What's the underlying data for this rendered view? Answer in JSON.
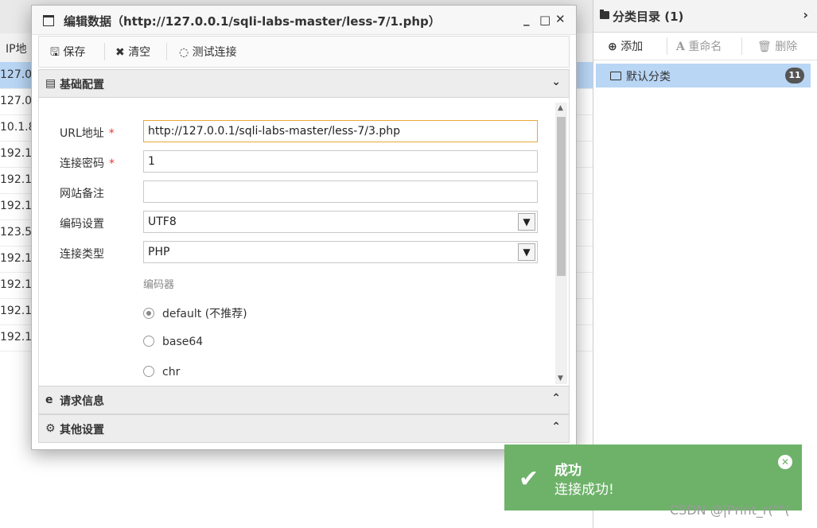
{
  "background_table": {
    "header": "IP地",
    "rows": [
      "127.0",
      "127.0",
      "10.1.8",
      "192.1",
      "192.1",
      "192.1",
      "123.5",
      "192.1",
      "192.1",
      "192.1",
      "192.1"
    ]
  },
  "right_panel": {
    "title": "分类目录 (1)",
    "buttons": {
      "add": "添加",
      "rename": "重命名",
      "delete": "删除"
    },
    "tree": {
      "label": "默认分类",
      "count": "11"
    }
  },
  "dialog": {
    "title": "编辑数据（http://127.0.0.1/sqli-labs-master/less-7/1.php）",
    "toolbar": {
      "save": "保存",
      "clear": "清空",
      "test": "测试连接"
    },
    "sections": {
      "basic": "基础配置",
      "request": "请求信息",
      "other": "其他设置"
    },
    "form": {
      "url_label": "URL地址",
      "url_value": "http://127.0.0.1/sqli-labs-master/less-7/3.php",
      "password_label": "连接密码",
      "password_value": "1",
      "note_label": "网站备注",
      "note_value": "",
      "encoding_label": "编码设置",
      "encoding_value": "UTF8",
      "type_label": "连接类型",
      "type_value": "PHP",
      "encoder_label": "编码器",
      "encoders": [
        "default (不推荐)",
        "base64",
        "chr"
      ],
      "required_mark": "*"
    }
  },
  "toast": {
    "title": "成功",
    "message": "连接成功!",
    "color": "#6eb26a"
  },
  "watermark": "CSDN @|Print_r(\"\"("
}
